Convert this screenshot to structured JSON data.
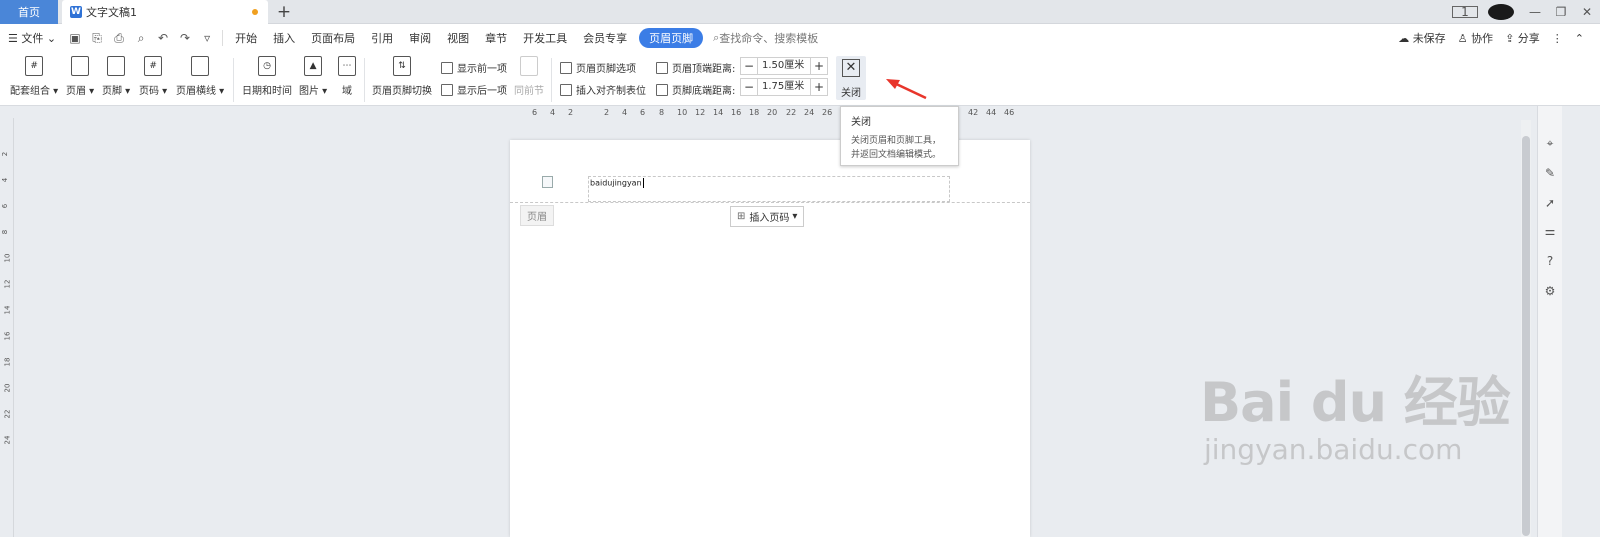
{
  "titlebar": {
    "home_tab": "首页",
    "doc_tab": "文字文稿1",
    "add_tab": "+",
    "badge": "1"
  },
  "menubar": {
    "file": "文件",
    "tabs": [
      "开始",
      "插入",
      "页面布局",
      "引用",
      "审阅",
      "视图",
      "章节",
      "开发工具",
      "会员专享"
    ],
    "active_tab": "页眉页脚",
    "search_placeholder": "查找命令、搜索模板",
    "unsaved": "未保存",
    "collab": "协作",
    "share": "分享"
  },
  "ribbon": {
    "combo": "配套组合",
    "header": "页眉",
    "footer": "页脚",
    "page_num": "页码",
    "header_line": "页眉横线",
    "datetime": "日期和时间",
    "picture": "图片",
    "field": "域",
    "switch": "页眉页脚切换",
    "show_prev": "显示前一项",
    "show_next": "显示后一项",
    "same_prev": "同前节",
    "options": "页眉页脚选项",
    "align_tab": "插入对齐制表位",
    "top_dist_label": "页眉顶端距离:",
    "top_dist_value": "1.50厘米",
    "bottom_dist_label": "页脚底端距离:",
    "bottom_dist_value": "1.75厘米",
    "close": "关闭"
  },
  "tooltip": {
    "title": "关闭",
    "desc1": "关闭页眉和页脚工具，",
    "desc2": "并返回文档编辑模式。"
  },
  "ruler_top": [
    "6",
    "4",
    "2",
    "2",
    "4",
    "6",
    "8",
    "10",
    "12",
    "14",
    "16",
    "18",
    "20",
    "22",
    "24",
    "26",
    "42",
    "44",
    "46"
  ],
  "ruler_left": [
    "2",
    "4",
    "6",
    "8",
    "10",
    "12",
    "14",
    "16",
    "18",
    "20",
    "22",
    "24"
  ],
  "document": {
    "header_text": "baidujingyan",
    "header_label": "页眉",
    "insert_page_num": "插入页码"
  },
  "watermark": {
    "main": "Bai du 经验",
    "sub": "jingyan.baidu.com"
  },
  "colors": {
    "accent": "#3b7de6",
    "home_tab": "#4a86d8",
    "arrow": "#e8352b"
  }
}
